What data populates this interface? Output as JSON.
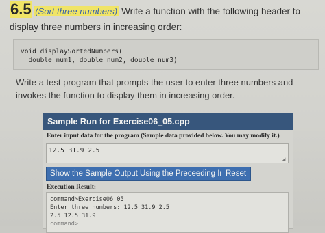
{
  "problem": {
    "number": "6.5",
    "name": "(Sort three numbers)",
    "description": "Write a function with the following header to display three numbers in increasing order:"
  },
  "code": {
    "lines": [
      "void displaySortedNumbers(",
      "  double num1, double num2, double num3)"
    ]
  },
  "test_description": "Write a test program that prompts the user to enter three numbers and invokes the function to display them in increasing order.",
  "sample_run": {
    "title": "Sample Run for Exercise06_05.cpp",
    "input_label": "Enter input data for the program (Sample data provided below. You may modify it.)",
    "input_value": "12.5 31.9 2.5",
    "show_button": "Show the Sample Output Using the Preceeding Input",
    "reset_button": "Reset",
    "execution_label": "Execution Result:",
    "result_lines": [
      "command>Exercise06_05",
      "Enter three numbers: 12.5 31.9 2.5",
      "2.5 12.5 31.9",
      "",
      "command>"
    ]
  },
  "colors": {
    "header_bg": "#37567c",
    "button_bg": "#3e6fb0",
    "highlight": "#f0e466",
    "link": "#3c66a8"
  }
}
